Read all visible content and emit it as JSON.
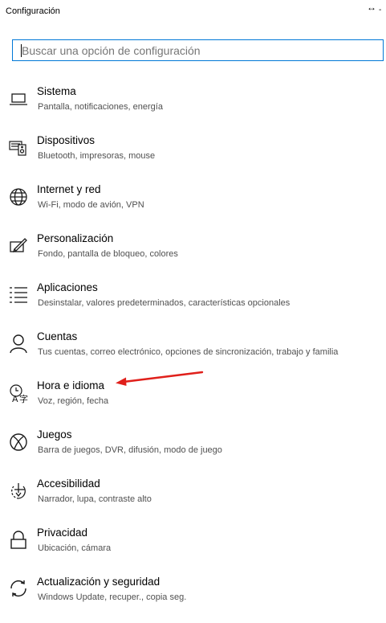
{
  "window": {
    "title": "Configuración",
    "restore_glyph": "↔",
    "minimize_glyph": "-"
  },
  "search": {
    "placeholder": "Buscar una opción de configuración",
    "value": ""
  },
  "items": [
    {
      "label": "Sistema",
      "desc": "Pantalla, notificaciones, energía",
      "icon": "laptop-icon"
    },
    {
      "label": "Dispositivos",
      "desc": "Bluetooth, impresoras, mouse",
      "icon": "devices-icon"
    },
    {
      "label": "Internet y red",
      "desc": "Wi-Fi, modo de avión, VPN",
      "icon": "globe-icon"
    },
    {
      "label": "Personalización",
      "desc": "Fondo, pantalla de bloqueo, colores",
      "icon": "personalization-icon"
    },
    {
      "label": "Aplicaciones",
      "desc": "Desinstalar, valores predeterminados, características opcionales",
      "icon": "apps-list-icon"
    },
    {
      "label": "Cuentas",
      "desc": "Tus cuentas, correo electrónico, opciones de sincronización, trabajo y familia",
      "icon": "person-icon"
    },
    {
      "label": "Hora e idioma",
      "desc": "Voz, región, fecha",
      "icon": "time-language-icon"
    },
    {
      "label": "Juegos",
      "desc": "Barra de juegos, DVR, difusión, modo de juego",
      "icon": "xbox-icon"
    },
    {
      "label": "Accesibilidad",
      "desc": "Narrador, lupa, contraste alto",
      "icon": "accessibility-icon"
    },
    {
      "label": "Privacidad",
      "desc": "Ubicación, cámara",
      "icon": "lock-icon"
    },
    {
      "label": "Actualización y seguridad",
      "desc": "Windows Update, recuper., copia seg.",
      "icon": "update-icon"
    }
  ],
  "colors": {
    "accent": "#0078d7",
    "annotation_arrow": "#e0201b",
    "description_text": "#505050"
  }
}
